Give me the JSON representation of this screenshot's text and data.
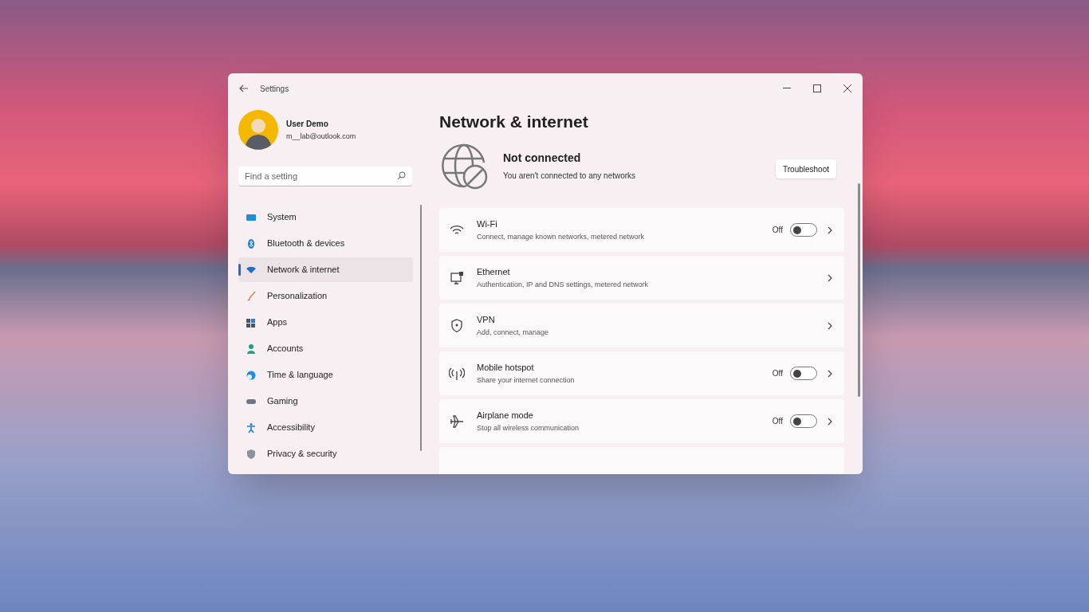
{
  "window": {
    "title": "Settings"
  },
  "user": {
    "name": "User Demo",
    "email": "m__lab@outlook.com"
  },
  "search": {
    "placeholder": "Find a setting"
  },
  "sidebar": {
    "items": [
      {
        "label": "System",
        "selected": false
      },
      {
        "label": "Bluetooth & devices",
        "selected": false
      },
      {
        "label": "Network & internet",
        "selected": true
      },
      {
        "label": "Personalization",
        "selected": false
      },
      {
        "label": "Apps",
        "selected": false
      },
      {
        "label": "Accounts",
        "selected": false
      },
      {
        "label": "Time & language",
        "selected": false
      },
      {
        "label": "Gaming",
        "selected": false
      },
      {
        "label": "Accessibility",
        "selected": false
      },
      {
        "label": "Privacy & security",
        "selected": false
      }
    ]
  },
  "page": {
    "title": "Network & internet"
  },
  "status": {
    "title": "Not connected",
    "description": "You aren't connected to any networks",
    "button": "Troubleshoot"
  },
  "cards": [
    {
      "kind": "toggle",
      "title": "Wi-Fi",
      "description": "Connect, manage known networks, metered network",
      "state_label": "Off",
      "on": false
    },
    {
      "kind": "link",
      "title": "Ethernet",
      "description": "Authentication, IP and DNS settings, metered network"
    },
    {
      "kind": "link",
      "title": "VPN",
      "description": "Add, connect, manage"
    },
    {
      "kind": "toggle",
      "title": "Mobile hotspot",
      "description": "Share your internet connection",
      "state_label": "Off",
      "on": false
    },
    {
      "kind": "toggle",
      "title": "Airplane mode",
      "description": "Stop all wireless communication",
      "state_label": "Off",
      "on": false
    },
    {
      "kind": "partial"
    }
  ]
}
